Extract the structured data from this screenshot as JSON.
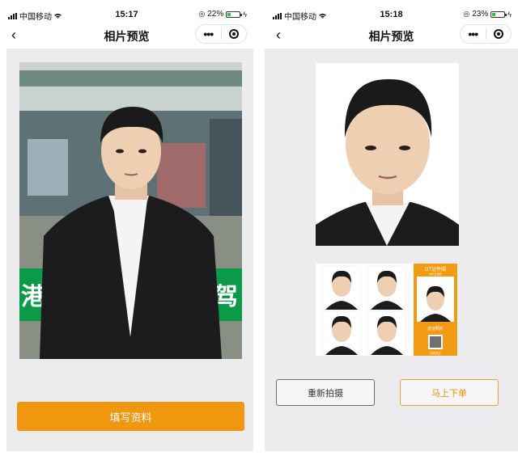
{
  "left_screen": {
    "status": {
      "carrier": "中国移动",
      "time": "15:17",
      "battery": "22%",
      "battery_level": 0.22
    },
    "nav": {
      "title": "相片预览"
    },
    "button": {
      "label": "填写资料"
    },
    "photo": {
      "sign_text": "港",
      "sign_text2": "驾"
    }
  },
  "right_screen": {
    "status": {
      "carrier": "中国移动",
      "time": "15:18",
      "battery": "23%",
      "battery_level": 0.23
    },
    "nav": {
      "title": "相片预览"
    },
    "card": {
      "brand": "OT证件照",
      "caption": "电子证件照",
      "label": "证证照片",
      "footer": "扫码关注"
    },
    "buttons": {
      "retake": "重新拍摄",
      "order": "马上下单"
    }
  },
  "colors": {
    "accent": "#f0960f",
    "panel": "#ececee",
    "sign_green": "#0a9a48"
  },
  "icons": [
    "signal-icon",
    "wifi-icon",
    "battery-icon",
    "back-icon",
    "more-icon",
    "close-target-icon"
  ]
}
